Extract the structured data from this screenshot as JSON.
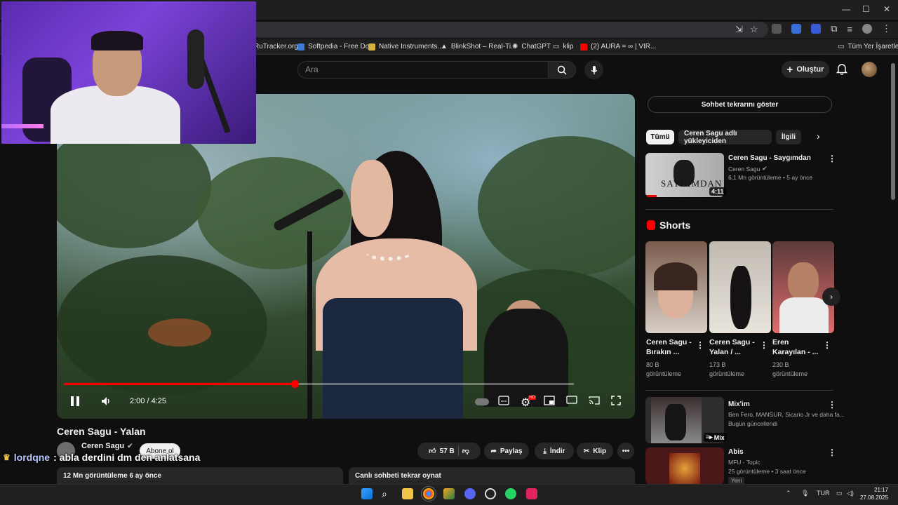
{
  "browser": {
    "window_controls": [
      "—",
      "☐",
      "✕"
    ],
    "bookmarks": [
      {
        "label": "RuTracker.org",
        "color": "#4a4a4a"
      },
      {
        "label": "Softpedia - Free Do...",
        "color": "#3b7bd6"
      },
      {
        "label": "Native Instruments...",
        "color": "#d6b13b"
      },
      {
        "label": "BlinkShot – Real-Ti...",
        "color": "#e0e0e0"
      },
      {
        "label": "ChatGPT",
        "color": "#bbbbbb"
      },
      {
        "label": "klip",
        "color": "#cfcfcf"
      },
      {
        "label": "(2) AURA = ∞ | VIR...",
        "color": "#ff0000"
      }
    ],
    "bookmarks_folder": "Tüm Yer İşaretleri"
  },
  "youtube_header": {
    "search_placeholder": "Ara",
    "create_label": "Oluştur"
  },
  "player": {
    "current_time": "2:00 / 4:25",
    "progress_fraction": 0.4528,
    "buffered_fraction": 1.0,
    "hd_badge": "HD"
  },
  "video": {
    "title": "Ceren Sagu - Yalan",
    "channel": "Ceren Sagu",
    "subscribe_label": "Abone ol",
    "likes": "57 B",
    "share_label": "Paylaş",
    "download_label": "İndir",
    "clip_label": "Klip",
    "views_date": "12 Mn görüntüleme  6 ay önce",
    "live_chat_replay": "Canlı sohbeti tekrar oynat"
  },
  "stream_chat": {
    "user": "lordqne",
    "message": ": abla derdini dm den anlatsana"
  },
  "sidebar": {
    "show_chat": "Sohbet tekrarını göster",
    "chips": [
      "Tümü",
      "Ceren Sagu adlı yükleyiciden",
      "İlgili"
    ],
    "top_rec": {
      "title": "Ceren Sagu - Saygımdan",
      "channel": "Ceren Sagu",
      "meta": "6,1 Mn görüntüleme • 5 ay önce",
      "duration": "4:11",
      "thumb_text": "SAYGIMDAN"
    },
    "shorts_title": "Shorts",
    "shorts": [
      {
        "title1": "Ceren Sagu -",
        "title2": "Bırakın ...",
        "views1": "80 B",
        "views2": "görüntüleme"
      },
      {
        "title1": "Ceren Sagu -",
        "title2": "Yalan / ...",
        "views1": "173 B",
        "views2": "görüntüleme"
      },
      {
        "title1": "Eren",
        "title2": "Karayılan - ...",
        "views1": "230 B",
        "views2": "görüntüleme"
      }
    ],
    "mix": {
      "title": "Mix'im",
      "meta1": "Ben Fero, MANSUR, Sicario Jr ve daha fa...",
      "meta2": "Bugün güncellendi",
      "badge": "Mix"
    },
    "abis": {
      "title": "Abis",
      "meta1": "MFU - Topic",
      "meta2": "25 görüntüleme • 3 saat önce",
      "badge": "Yeni"
    }
  },
  "taskbar": {
    "lang": "TUR",
    "time": "21:17",
    "date": "27.08.2025"
  }
}
